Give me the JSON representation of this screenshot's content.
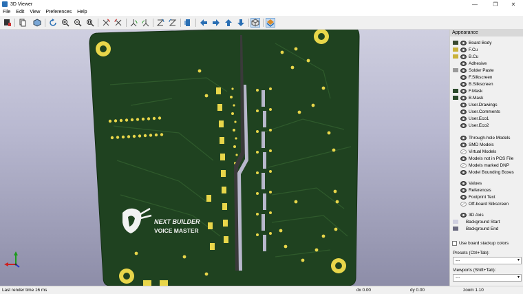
{
  "window": {
    "title": "3D Viewer",
    "controls": [
      "—",
      "❐",
      "✕"
    ]
  },
  "menu": [
    "File",
    "Edit",
    "View",
    "Preferences",
    "Help"
  ],
  "board": {
    "logo_line1": "NEXT BUILDER",
    "logo_line2": "VOICE MASTER",
    "colors": {
      "pcb": "#1f4220",
      "pad": "#e8d64a",
      "silk": "#f2f2f2",
      "trace": "#2f5a2c"
    }
  },
  "panel": {
    "header": "Appearance",
    "layers": [
      {
        "label": "Board Body",
        "swatch": "#3a4a30"
      },
      {
        "label": "F.Cu",
        "swatch": "#c9b23a"
      },
      {
        "label": "B.Cu",
        "swatch": "#c9b23a"
      },
      {
        "label": "Adhesive",
        "swatch": ""
      },
      {
        "label": "Solder Paste",
        "swatch": "#9a9a9a"
      },
      {
        "label": "F.Silkscreen",
        "swatch": ""
      },
      {
        "label": "B.Silkscreen",
        "swatch": ""
      },
      {
        "label": "F.Mask",
        "swatch": "#2b4a2b"
      },
      {
        "label": "B.Mask",
        "swatch": "#2b4a2b"
      },
      {
        "label": "User.Drawings",
        "swatch": ""
      },
      {
        "label": "User.Comments",
        "swatch": ""
      },
      {
        "label": "User.Eco1",
        "swatch": ""
      },
      {
        "label": "User.Eco2",
        "swatch": ""
      }
    ],
    "models": [
      {
        "label": "Through-hole Models",
        "visible": true
      },
      {
        "label": "SMD Models",
        "visible": true
      },
      {
        "label": "Virtual Models",
        "visible": false
      },
      {
        "label": "Models not in POS File",
        "visible": true
      },
      {
        "label": "Models marked DNP",
        "visible": false
      },
      {
        "label": "Model Bounding Boxes",
        "visible": true
      }
    ],
    "extras": [
      {
        "label": "Values",
        "visible": true
      },
      {
        "label": "References",
        "visible": true
      },
      {
        "label": "Footprint Text",
        "visible": true
      },
      {
        "label": "Off-board Silkscreen",
        "visible": false
      }
    ],
    "axis": [
      {
        "label": "3D Axis",
        "swatch": ""
      },
      {
        "label": "Background Start",
        "swatch": "#cfcfe0"
      },
      {
        "label": "Background End",
        "swatch": "#6a6a80"
      }
    ],
    "stackup_label": "Use board stackup colors",
    "presets_label": "Presets (Ctrl+Tab):",
    "presets_value": "---",
    "viewports_label": "Viewports (Shift+Tab):",
    "viewports_value": "---"
  },
  "status": {
    "render": "Last render time 16 ms",
    "dx": "dx 0.00",
    "dy": "dy 0.00",
    "zoom": "zoom 1.10"
  }
}
